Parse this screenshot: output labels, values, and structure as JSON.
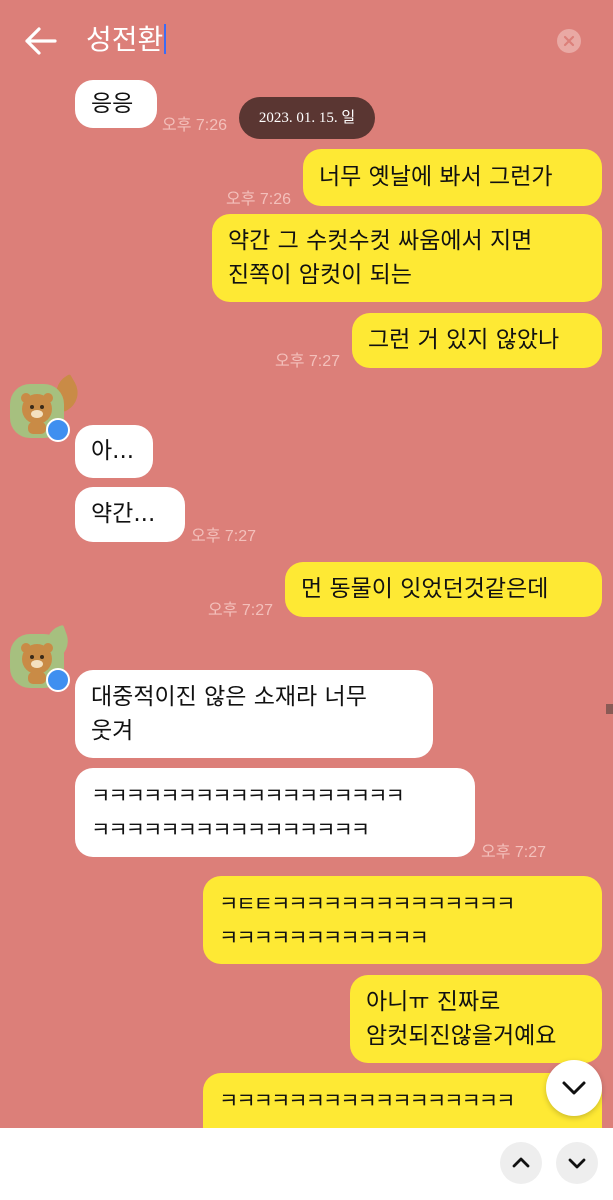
{
  "header": {
    "title": "성전환"
  },
  "date_divider": "2023. 01. 15. 일",
  "messages": [
    {
      "side": "in",
      "text": "응응",
      "time": "오후 7:26"
    },
    {
      "side": "out",
      "text": "너무 옛날에 봐서 그런가",
      "time": "오후 7:26"
    },
    {
      "side": "out",
      "text": "약간 그 수컷수컷 싸움에서 지면\n진쪽이 암컷이 되는",
      "time": ""
    },
    {
      "side": "out",
      "text": "그런 거 있지 않았나",
      "time": "오후 7:27"
    },
    {
      "side": "in",
      "text": "아...",
      "time": ""
    },
    {
      "side": "in",
      "text": "약간...",
      "time": "오후 7:27"
    },
    {
      "side": "out",
      "text": "먼 동물이 잇었던것같은데",
      "time": "오후 7:27"
    },
    {
      "side": "in",
      "text": "대중적이진 않은 소재라 너무\n웃겨",
      "time": ""
    },
    {
      "side": "in",
      "text": "ㅋㅋㅋㅋㅋㅋㅋㅋㅋㅋㅋㅋㅋㅋㅋㅋㅋㅋ\nㅋㅋㅋㅋㅋㅋㅋㅋㅋㅋㅋㅋㅋㅋㅋㅋ",
      "time": "오후 7:27"
    },
    {
      "side": "out",
      "text": "ㅋㅌㅌㅋㅋㅋㅋㅋㅋㅋㅋㅋㅋㅋㅋㅋㅋ\nㅋㅋㅋㅋㅋㅋㅋㅋㅋㅋㅋㅋ",
      "time": ""
    },
    {
      "side": "out",
      "text": "아니ㅠ 진짜로\n암컷되진않을거예요",
      "time": ""
    },
    {
      "side": "out",
      "text": "ㅋㅋㅋㅋㅋㅋㅋㅋㅋㅋㅋㅋㅋㅋㅋㅋㅋ\nㅋㅋㅋㅋㅋㅋ",
      "time": ""
    }
  ],
  "icons": {
    "back": "back-arrow-icon",
    "clear": "clear-icon",
    "scroll_down": "chevron-down-icon",
    "nav_up": "chevron-up-icon",
    "nav_down": "chevron-down-icon",
    "avatar": "profile-avatar"
  },
  "colors": {
    "background": "#dc7f79",
    "incoming_bubble": "#ffffff",
    "outgoing_bubble": "#fee934",
    "date_pill": "#5a3632",
    "timestamp": "#f3c0bb",
    "cursor": "#3b6cf5",
    "badge": "#3f8ff0"
  }
}
